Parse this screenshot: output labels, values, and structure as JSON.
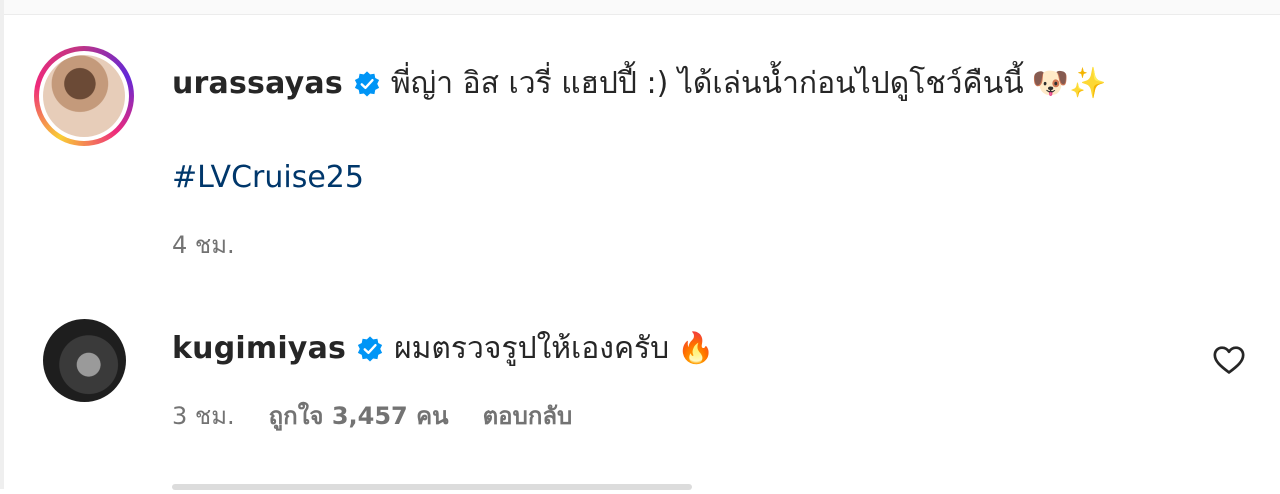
{
  "comments": [
    {
      "username": "urassayas",
      "verified": true,
      "text": "พี่ญ่า อิส เวรี่ แฮปปี้ :) ได้เล่นน้ำก่อนไปดูโชว์คืนนี้",
      "emoji": "🐶✨",
      "hashtag": "#LVCruise25",
      "time": "4 ชม.",
      "story_ring": true
    },
    {
      "username": "kugimiyas",
      "verified": true,
      "text": "ผมตรวจรูปให้เองครับ",
      "emoji": "🔥",
      "time": "3 ชม.",
      "likes": "ถูกใจ 3,457 คน",
      "reply_label": "ตอบกลับ",
      "like_icon": "heart-outline-icon"
    }
  ],
  "colors": {
    "verified_blue": "#0095f6",
    "hashtag": "#00376b",
    "meta_gray": "#737373",
    "text": "#262626"
  }
}
